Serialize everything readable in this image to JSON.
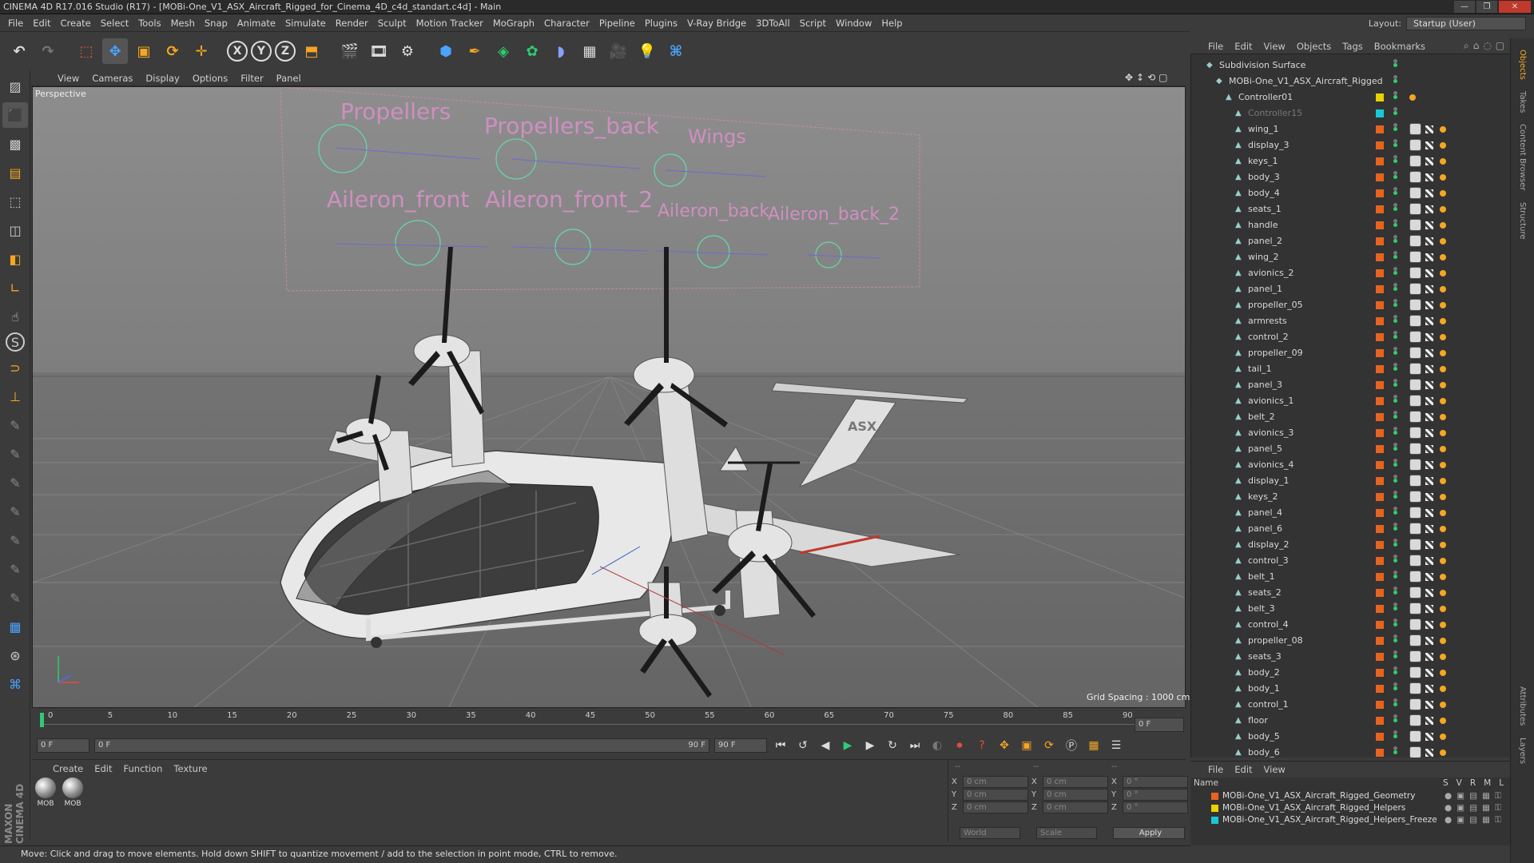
{
  "window": {
    "title": "CINEMA 4D R17.016 Studio (R17) - [MOBi-One_V1_ASX_Aircraft_Rigged_for_Cinema_4D_c4d_standart.c4d] - Main"
  },
  "menubar": [
    "File",
    "Edit",
    "Create",
    "Select",
    "Tools",
    "Mesh",
    "Snap",
    "Animate",
    "Simulate",
    "Render",
    "Sculpt",
    "Motion Tracker",
    "MoGraph",
    "Character",
    "Pipeline",
    "Plugins",
    "V-Ray Bridge",
    "3DToAll",
    "Script",
    "Window",
    "Help"
  ],
  "layout": {
    "label": "Layout:",
    "value": "Startup (User)"
  },
  "viewport": {
    "menu": [
      "View",
      "Cameras",
      "Display",
      "Options",
      "Filter",
      "Panel"
    ],
    "label": "Perspective",
    "grid_spacing": "Grid Spacing : 1000 cm",
    "rig_labels": [
      "Propellers",
      "Propellers_back",
      "Wings",
      "Aileron_front",
      "Aileron_front_2",
      "Aileron_back",
      "Aileron_back_2"
    ],
    "tail_text": "ASX"
  },
  "timeline": {
    "ticks": [
      "0",
      "5",
      "10",
      "15",
      "20",
      "25",
      "30",
      "35",
      "40",
      "45",
      "50",
      "55",
      "60",
      "65",
      "70",
      "75",
      "80",
      "85",
      "90"
    ],
    "frame_end_field": "0 F"
  },
  "playbar": {
    "current": "0 F",
    "range_start": "0 F",
    "range_end": "90 F",
    "end": "90 F"
  },
  "material_manager": {
    "menu": [
      "Create",
      "Edit",
      "Function",
      "Texture"
    ],
    "materials": [
      "MOB",
      "MOB"
    ]
  },
  "coordinates": {
    "rows": [
      {
        "a": "X",
        "av": "0 cm",
        "b": "X",
        "bv": "0 cm",
        "c": "X",
        "cv": "0 °"
      },
      {
        "a": "Y",
        "av": "0 cm",
        "b": "Y",
        "bv": "0 cm",
        "c": "Y",
        "cv": "0 °"
      },
      {
        "a": "Z",
        "av": "0 cm",
        "b": "Z",
        "bv": "0 cm",
        "c": "Z",
        "cv": "0 °"
      }
    ],
    "mode": "World",
    "scale": "Scale",
    "apply": "Apply",
    "header": [
      "--",
      "--",
      "--"
    ]
  },
  "status": "Move: Click and drag to move elements. Hold down SHIFT to quantize movement / add to the selection in point mode, CTRL to remove.",
  "object_manager": {
    "menu": [
      "File",
      "Edit",
      "View",
      "Objects",
      "Tags",
      "Bookmarks"
    ],
    "objects": [
      {
        "name": "Subdivision Surface",
        "indent": 0,
        "layer": "",
        "tags": 0
      },
      {
        "name": "MOBi-One_V1_ASX_Aircraft_Rigged",
        "indent": 1,
        "layer": "",
        "tags": 0
      },
      {
        "name": "Controller01",
        "indent": 2,
        "layer": "#e8d200",
        "tags": 1
      },
      {
        "name": "Controller15",
        "indent": 3,
        "layer": "#19c8d6",
        "tags": 0,
        "dim": true
      },
      {
        "name": "wing_1",
        "indent": 3,
        "layer": "#e8641e",
        "tags": 4
      },
      {
        "name": "display_3",
        "indent": 3,
        "layer": "#e8641e",
        "tags": 3
      },
      {
        "name": "keys_1",
        "indent": 3,
        "layer": "#e8641e",
        "tags": 3
      },
      {
        "name": "body_3",
        "indent": 3,
        "layer": "#e8641e",
        "tags": 3
      },
      {
        "name": "body_4",
        "indent": 3,
        "layer": "#e8641e",
        "tags": 3
      },
      {
        "name": "seats_1",
        "indent": 3,
        "layer": "#e8641e",
        "tags": 3
      },
      {
        "name": "handle",
        "indent": 3,
        "layer": "#e8641e",
        "tags": 3
      },
      {
        "name": "panel_2",
        "indent": 3,
        "layer": "#e8641e",
        "tags": 3
      },
      {
        "name": "wing_2",
        "indent": 3,
        "layer": "#e8641e",
        "tags": 3
      },
      {
        "name": "avionics_2",
        "indent": 3,
        "layer": "#e8641e",
        "tags": 3
      },
      {
        "name": "panel_1",
        "indent": 3,
        "layer": "#e8641e",
        "tags": 3
      },
      {
        "name": "propeller_05",
        "indent": 3,
        "layer": "#e8641e",
        "tags": 3
      },
      {
        "name": "armrests",
        "indent": 3,
        "layer": "#e8641e",
        "tags": 3
      },
      {
        "name": "control_2",
        "indent": 3,
        "layer": "#e8641e",
        "tags": 3
      },
      {
        "name": "propeller_09",
        "indent": 3,
        "layer": "#e8641e",
        "tags": 3
      },
      {
        "name": "tail_1",
        "indent": 3,
        "layer": "#e8641e",
        "tags": 3
      },
      {
        "name": "panel_3",
        "indent": 3,
        "layer": "#e8641e",
        "tags": 3
      },
      {
        "name": "avionics_1",
        "indent": 3,
        "layer": "#e8641e",
        "tags": 3
      },
      {
        "name": "belt_2",
        "indent": 3,
        "layer": "#e8641e",
        "tags": 3
      },
      {
        "name": "avionics_3",
        "indent": 3,
        "layer": "#e8641e",
        "tags": 3
      },
      {
        "name": "panel_5",
        "indent": 3,
        "layer": "#e8641e",
        "tags": 3
      },
      {
        "name": "avionics_4",
        "indent": 3,
        "layer": "#e8641e",
        "tags": 3
      },
      {
        "name": "display_1",
        "indent": 3,
        "layer": "#e8641e",
        "tags": 3
      },
      {
        "name": "keys_2",
        "indent": 3,
        "layer": "#e8641e",
        "tags": 3
      },
      {
        "name": "panel_4",
        "indent": 3,
        "layer": "#e8641e",
        "tags": 3
      },
      {
        "name": "panel_6",
        "indent": 3,
        "layer": "#e8641e",
        "tags": 3
      },
      {
        "name": "display_2",
        "indent": 3,
        "layer": "#e8641e",
        "tags": 3
      },
      {
        "name": "control_3",
        "indent": 3,
        "layer": "#e8641e",
        "tags": 3
      },
      {
        "name": "belt_1",
        "indent": 3,
        "layer": "#e8641e",
        "tags": 3
      },
      {
        "name": "seats_2",
        "indent": 3,
        "layer": "#e8641e",
        "tags": 3
      },
      {
        "name": "belt_3",
        "indent": 3,
        "layer": "#e8641e",
        "tags": 3
      },
      {
        "name": "control_4",
        "indent": 3,
        "layer": "#e8641e",
        "tags": 3
      },
      {
        "name": "propeller_08",
        "indent": 3,
        "layer": "#e8641e",
        "tags": 3
      },
      {
        "name": "seats_3",
        "indent": 3,
        "layer": "#e8641e",
        "tags": 3
      },
      {
        "name": "body_2",
        "indent": 3,
        "layer": "#e8641e",
        "tags": 3
      },
      {
        "name": "body_1",
        "indent": 3,
        "layer": "#e8641e",
        "tags": 3
      },
      {
        "name": "control_1",
        "indent": 3,
        "layer": "#e8641e",
        "tags": 3
      },
      {
        "name": "floor",
        "indent": 3,
        "layer": "#e8641e",
        "tags": 3
      },
      {
        "name": "body_5",
        "indent": 3,
        "layer": "#e8641e",
        "tags": 3
      },
      {
        "name": "body_6",
        "indent": 3,
        "layer": "#e8641e",
        "tags": 3
      }
    ]
  },
  "layer_manager": {
    "menu": [
      "File",
      "Edit",
      "View"
    ],
    "header": {
      "name": "Name",
      "cols": [
        "S",
        "V",
        "R",
        "M",
        "L"
      ]
    },
    "layers": [
      {
        "name": "MOBi-One_V1_ASX_Aircraft_Rigged_Geometry",
        "color": "#e8641e"
      },
      {
        "name": "MOBi-One_V1_ASX_Aircraft_Rigged_Helpers",
        "color": "#e8d200"
      },
      {
        "name": "MOBi-One_V1_ASX_Aircraft_Rigged_Helpers_Freeze",
        "color": "#19c8d6"
      }
    ]
  },
  "right_tabs": [
    "Objects",
    "Takes",
    "Content Browser",
    "Structure",
    "Attributes",
    "Layers"
  ],
  "brand": "MAXON CINEMA 4D"
}
